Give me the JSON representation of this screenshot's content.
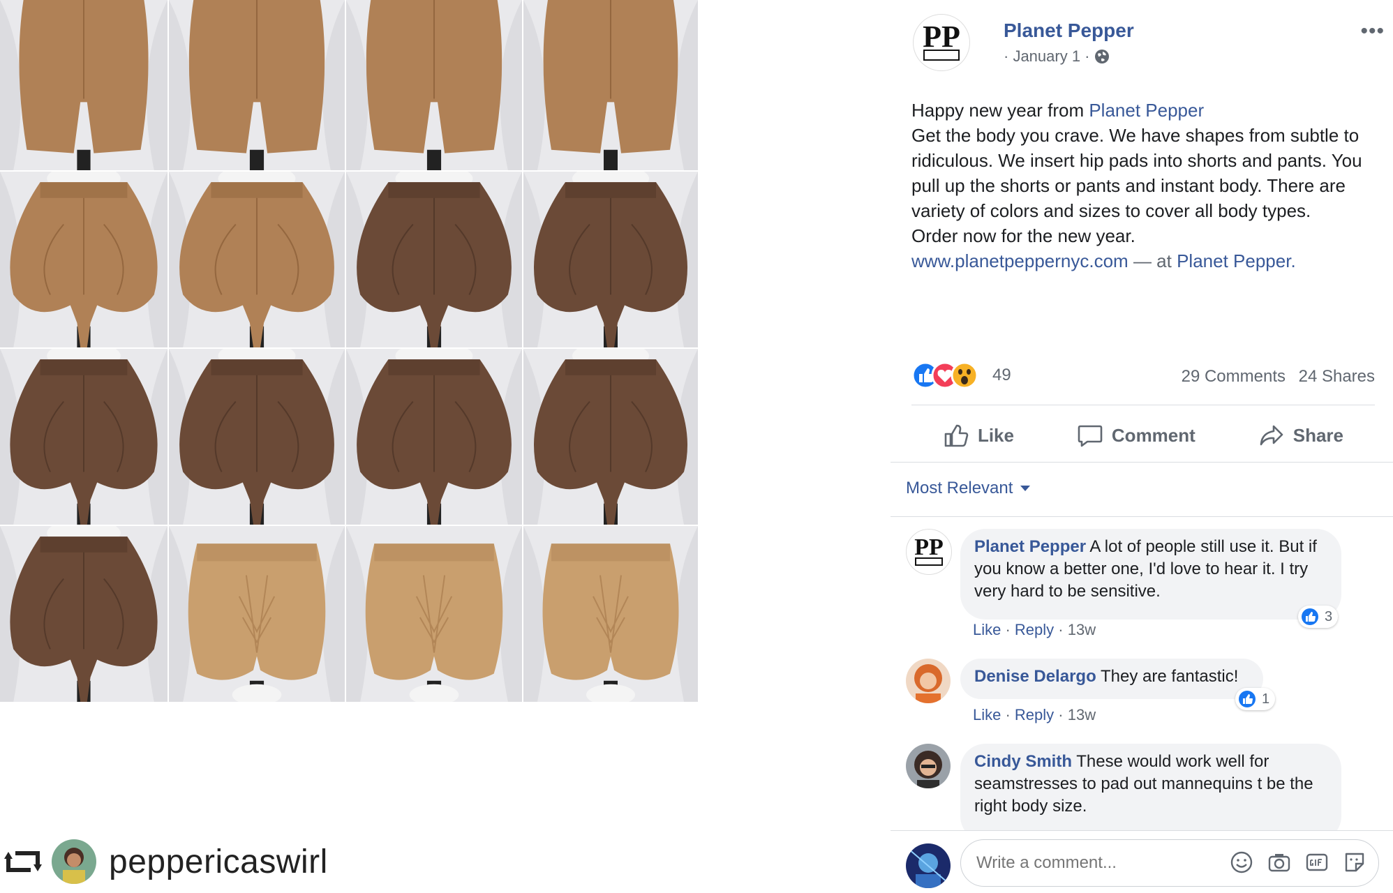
{
  "repost": {
    "username": "peppericaswirl"
  },
  "post": {
    "page_name": "Planet Pepper",
    "date": "· January 1 ·",
    "body_line1_prefix": "Happy new year from ",
    "body_line1_link": "Planet Pepper",
    "body_paragraph": "Get the body you crave. We have shapes from subtle to ridiculous. We insert hip pads into shorts and pants. You pull up the shorts or pants and instant body. There are variety of colors and sizes to cover all body types.",
    "body_order": "Order now for the new year.",
    "url": "www.planetpeppernyc.com",
    "at_separator": " — at ",
    "location": "Planet Pepper",
    "location_period": "."
  },
  "reactions": {
    "count": "49",
    "comments": "29 Comments",
    "shares": "24 Shares",
    "types": [
      "like-icon",
      "love-icon",
      "wow-icon"
    ]
  },
  "actions": {
    "like": "Like",
    "comment": "Comment",
    "share": "Share"
  },
  "sort_label": "Most Relevant",
  "comments": [
    {
      "author": "Planet Pepper",
      "text": " A lot of people still use it. But if you know a better one, I'd love to hear it. I try very hard to be sensitive.",
      "like": "Like",
      "reply": "Reply",
      "time": "13w",
      "reaction_count": "3"
    },
    {
      "author": "Denise Delargo",
      "text": " They are fantastic!",
      "like": "Like",
      "reply": "Reply",
      "time": "13w",
      "reaction_count": "1"
    },
    {
      "author": "Cindy Smith",
      "text": " These would work well for seamstresses to pad out mannequins t be the right body size."
    }
  ],
  "composer": {
    "placeholder": "Write a comment..."
  },
  "colors": {
    "link": "#385898",
    "muted": "#606770",
    "tan": "#b08156",
    "brown": "#6b4a37",
    "light_tan": "#c99f6e",
    "backdrop": "#e9e9ec"
  }
}
